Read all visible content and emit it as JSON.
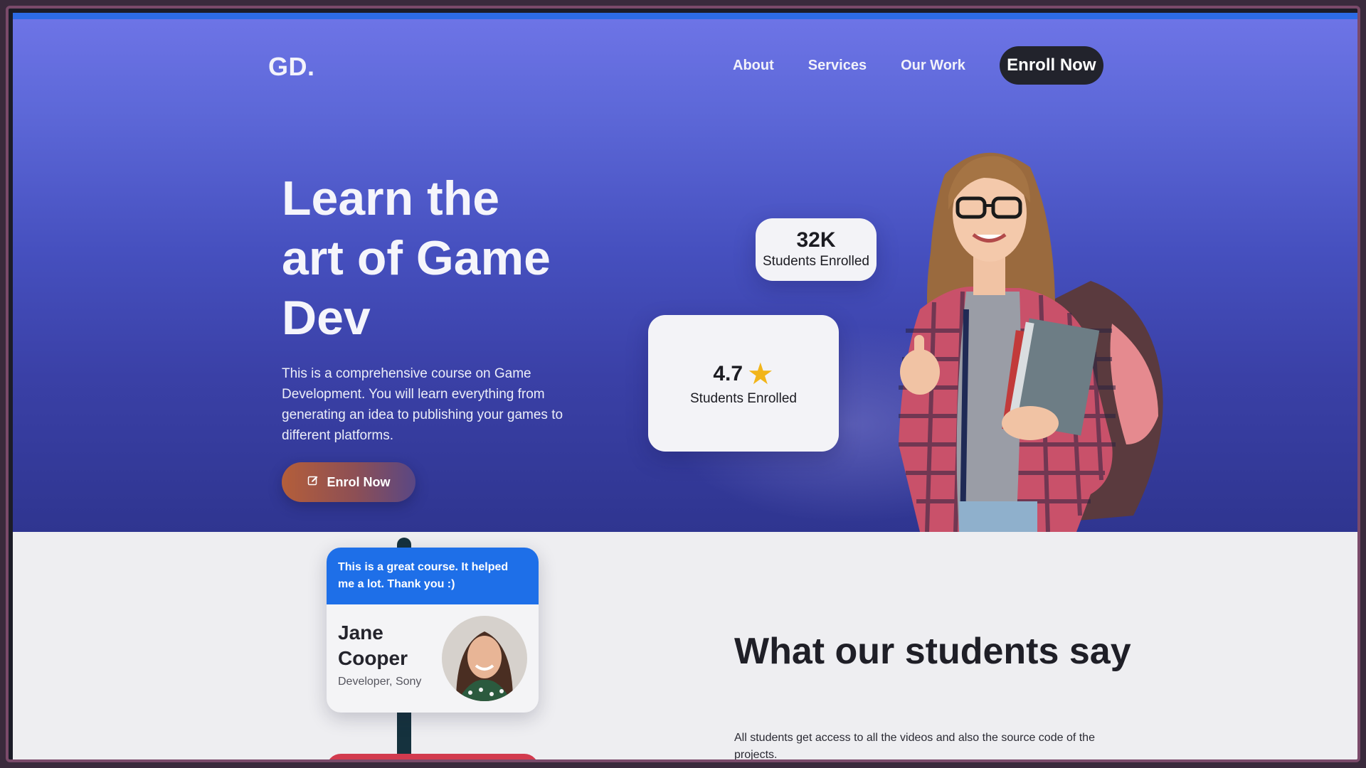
{
  "header": {
    "logo": "GD.",
    "nav": [
      "About",
      "Services",
      "Our Work"
    ],
    "cta": "Enroll Now"
  },
  "hero": {
    "title_lines": [
      "Learn the",
      "art of Game",
      "Dev"
    ],
    "description": "This is a comprehensive course on Game Development. You will learn everything from generating an idea to publishing your games to different platforms.",
    "cta": "Enrol Now",
    "cta_icon": "edit-icon"
  },
  "stats": [
    {
      "value": "32K",
      "label": "Students Enrolled"
    },
    {
      "value": "4.7",
      "label": "Students Enrolled",
      "icon": "star-icon"
    }
  ],
  "testimonials": {
    "title": "What our students say",
    "description": "All students get access to all the videos and also the source code of the projects.",
    "items": [
      {
        "quote": "This is a great course. It helped me a lot. Thank you :)",
        "name": "Jane Cooper",
        "role": "Developer, Sony"
      }
    ]
  },
  "colors": {
    "accent_blue": "#2d6be6",
    "hero_top": "#6d74e6",
    "hero_bottom": "#2f3590",
    "cta_dark": "#22232c",
    "star": "#f2b51a",
    "quote_bg": "#1e6fe8",
    "second_card": "#d23a4e"
  }
}
